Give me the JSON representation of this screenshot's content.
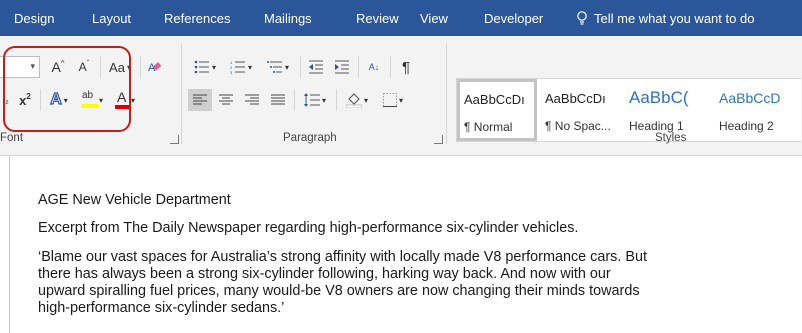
{
  "tabs": [
    "Design",
    "Layout",
    "References",
    "Mailings",
    "Review",
    "View",
    "Developer"
  ],
  "tell_me": "Tell me what you want to do",
  "font_group": {
    "label": "Font",
    "grow_font": "A",
    "shrink_font": "A",
    "change_case": "Aa",
    "font_color_letter": "A",
    "subscript": "x",
    "superscript": "x",
    "text_effects_letter": "A",
    "highlight_letters": "ab"
  },
  "paragraph_group": {
    "label": "Paragraph",
    "sort": "A↓",
    "pilcrow": "¶"
  },
  "styles_group": {
    "label": "Styles",
    "items": [
      {
        "sample": "AaBbCcDı",
        "name": "¶ Normal"
      },
      {
        "sample": "AaBbCcDı",
        "name": "¶ No Spac..."
      },
      {
        "sample": "AaBbC(",
        "name": "Heading 1"
      },
      {
        "sample": "AaBbCcD",
        "name": "Heading 2"
      }
    ]
  },
  "colors": {
    "ribbon_tab_bg": "#2b579a",
    "highlight_annotation": "#c0201b",
    "heading_blue": "#2e74b5"
  },
  "document": {
    "title": "AGE New Vehicle Department",
    "excerpt": "Excerpt from The Daily Newspaper regarding high-performance six-cylinder vehicles.",
    "quote_lines": [
      "‘Blame our vast spaces for Australia’s strong affinity with locally made V8 performance cars. But",
      "there has always been a strong six-cylinder following, harking way back. And now with our",
      "upward spiralling fuel prices, many would-be V8 owners are now changing their minds towards",
      "high-performance six-cylinder sedans.’"
    ]
  }
}
